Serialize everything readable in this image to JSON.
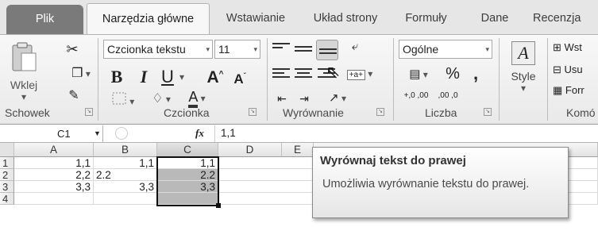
{
  "tabs": [
    "Plik",
    "Narzędzia główne",
    "Wstawianie",
    "Układ strony",
    "Formuły",
    "Dane",
    "Recenzja"
  ],
  "clipboard": {
    "paste_label": "Wklej",
    "group_label": "Schowek"
  },
  "font": {
    "name": "Czcionka tekstu",
    "size": "11",
    "group_label": "Czcionka",
    "bold": "B",
    "italic": "I",
    "underline": "U",
    "grow": "A",
    "shrink": "A",
    "color_a": "A"
  },
  "alignment": {
    "group_label": "Wyrównanie",
    "merge_glyph": "+a+"
  },
  "number": {
    "format": "Ogólne",
    "percent": "%",
    "comma": ",",
    "inc_decimal": "+,0 ,00",
    "dec_decimal": ",00 ,0",
    "group_label": "Liczba"
  },
  "styles": {
    "label": "Style"
  },
  "cells": {
    "insert": "Wst",
    "delete": "Usu",
    "format": "Forr",
    "group_label": "Komó"
  },
  "formula_bar": {
    "name_box": "C1",
    "fx": "fx",
    "value": "1,1"
  },
  "grid": {
    "columns": [
      "A",
      "B",
      "C",
      "D",
      "E"
    ],
    "rows": [
      {
        "num": "1",
        "a": "1,1",
        "b": "1,1",
        "c": "1,1"
      },
      {
        "num": "2",
        "a": "2,2",
        "b": "2.2",
        "c": "2.2"
      },
      {
        "num": "3",
        "a": "3,3",
        "b": "3,3",
        "c": "3,3"
      },
      {
        "num": "4",
        "a": "",
        "b": "",
        "c": ""
      }
    ]
  },
  "tooltip": {
    "title": "Wyrównaj tekst do prawej",
    "body": "Umożliwia wyrównanie tekstu do prawej."
  }
}
